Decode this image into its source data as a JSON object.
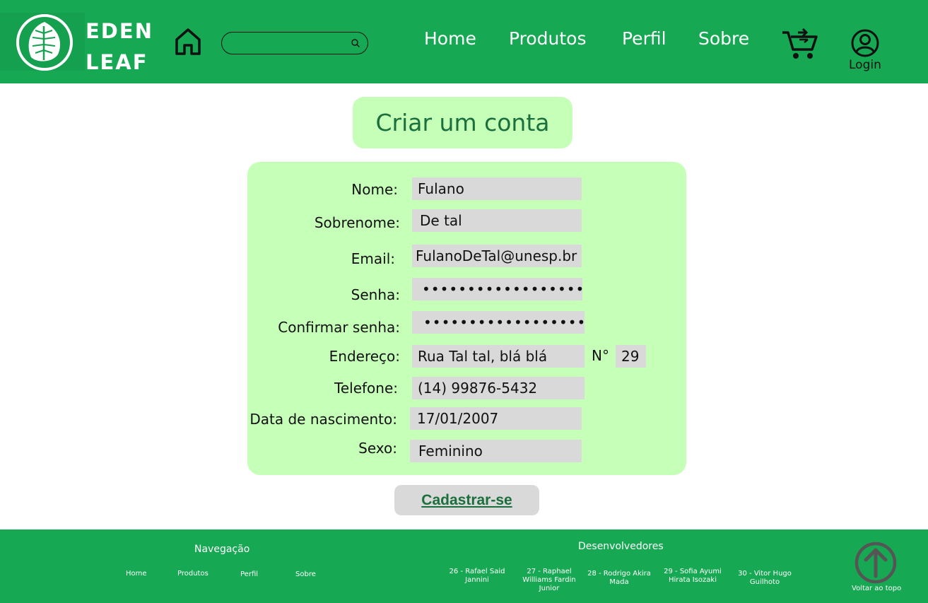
{
  "header": {
    "brand_line1": "EDEN",
    "brand_line2": "LEAF",
    "search": {
      "value": "",
      "placeholder": ""
    },
    "nav": [
      "Home",
      "Produtos",
      "Perfil",
      "Sobre"
    ],
    "login_label": "Login",
    "icons": [
      "leaf-logo-icon",
      "home-icon",
      "search-icon",
      "cart-icon",
      "user-icon"
    ]
  },
  "page": {
    "title": "Criar um conta",
    "form": {
      "nome_label": "Nome:",
      "nome_value": "Fulano",
      "sobrenome_label": "Sobrenome:",
      "sobrenome_value": "De tal",
      "email_label": "Email:",
      "email_value": "FulanoDeTal@unesp.br",
      "senha_label": "Senha:",
      "senha_value": "••••••••••••••••••",
      "confirmar_label": "Confirmar senha:",
      "confirmar_value": "••••••••••••••••••",
      "endereco_label": "Endereço:",
      "endereco_value": "Rua Tal tal, blá blá",
      "numero_label": "N°",
      "numero_value": "29",
      "telefone_label": "Telefone:",
      "telefone_value": "(14) 99876-5432",
      "nascimento_label": "Data de nascimento:",
      "nascimento_value": "17/01/2007",
      "sexo_label": "Sexo:",
      "sexo_value": "Feminino"
    },
    "submit_label": "Cadastrar-se"
  },
  "footer": {
    "nav_heading": "Navegação",
    "nav_links": [
      "Home",
      "Produtos",
      "Perfil",
      "Sobre"
    ],
    "dev_heading": "Desenvolvedores",
    "developers": [
      "26 - Rafael Said Jannini",
      "27 - Raphael Williams Fardin Junior",
      "28 - Rodrigo Akira Mada",
      "29 - Sofia Ayumi Hirata Isozaki",
      "30 - Vitor Hugo Guilhoto"
    ],
    "back_to_top": "Voltar ao topo"
  },
  "colors": {
    "primary_green": "#17a853",
    "light_green": "#c5ffb8",
    "dark_green_text": "#1a6f3c",
    "field_gray": "#d9d9d9"
  }
}
